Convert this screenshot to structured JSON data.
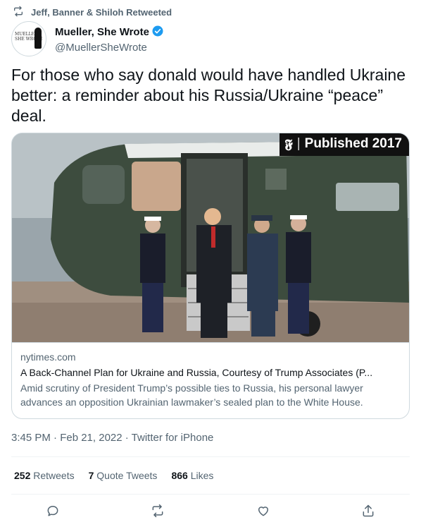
{
  "retweet": {
    "text": "Jeff, Banner & Shiloh Retweeted"
  },
  "author": {
    "display_name": "Mueller, She Wrote",
    "handle": "@MuellerSheWrote",
    "avatar_text": "MUELLER SHE WROTE",
    "verified": true
  },
  "tweet": {
    "text": "For those who say donald would have handled Ukraine better: a reminder about his Russia/Ukraine “peace” deal."
  },
  "card": {
    "badge_logo": "𝕱",
    "badge_text": "Published 2017",
    "domain": "nytimes.com",
    "title": "A Back-Channel Plan for Ukraine and Russia, Courtesy of Trump Associates (P...",
    "description": "Amid scrutiny of President Trump’s possible ties to Russia, his personal lawyer advances an opposition Ukrainian lawmaker’s sealed plan to the White House."
  },
  "meta": {
    "text": "3:45 PM · Feb 21, 2022 · Twitter for iPhone"
  },
  "stats": {
    "retweets_count": "252",
    "retweets_label": "Retweets",
    "quotes_count": "7",
    "quotes_label": "Quote Tweets",
    "likes_count": "866",
    "likes_label": "Likes"
  },
  "colors": {
    "secondary_text": "#536471",
    "verified_blue": "#1d9bf0",
    "border": "#cfd9de"
  },
  "icons": [
    "retweet-icon",
    "verified-icon",
    "reply-icon",
    "like-icon",
    "share-icon"
  ]
}
